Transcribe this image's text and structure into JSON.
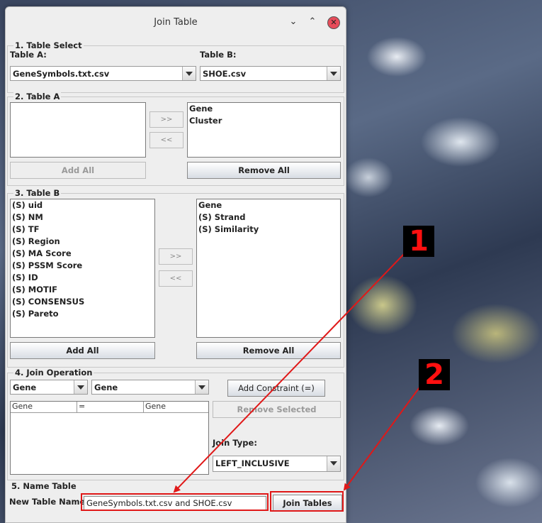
{
  "window": {
    "title": "Join Table"
  },
  "table_select": {
    "heading": "1. Table Select",
    "table_a_label": "Table A:",
    "table_b_label": "Table B:",
    "table_a_value": "GeneSymbols.txt.csv",
    "table_b_value": "SHOE.csv"
  },
  "table_a": {
    "heading": "2. Table A",
    "available": [],
    "selected": [
      "Gene",
      "Cluster"
    ],
    "add_label": ">>",
    "remove_label": "<<",
    "add_all_label": "Add All",
    "remove_all_label": "Remove All"
  },
  "table_b": {
    "heading": "3. Table B",
    "available": [
      "(S) uid",
      "(S) NM",
      "(S) TF",
      "(S) Region",
      "(S) MA Score",
      "(S) PSSM Score",
      "(S) ID",
      "(S) MOTIF",
      "(S) CONSENSUS",
      "(S) Pareto"
    ],
    "selected": [
      "Gene",
      "(S) Strand",
      "(S) Similarity"
    ],
    "add_label": ">>",
    "remove_label": "<<",
    "add_all_label": "Add All",
    "remove_all_label": "Remove All"
  },
  "join_operation": {
    "heading": "4. Join Operation",
    "left_field": "Gene",
    "right_field": "Gene",
    "add_constraint_label": "Add Constraint (=)",
    "remove_selected_label": "Remove Selected",
    "constraint_columns": [
      "Gene",
      "=",
      "Gene"
    ],
    "join_type_label": "Join Type:",
    "join_type_value": "LEFT_INCLUSIVE"
  },
  "name_table": {
    "heading": "5. Name Table",
    "new_name_label": "New Table Name:",
    "new_name_value": "GeneSymbols.txt.csv and SHOE.csv",
    "join_button_label": "Join Tables"
  },
  "annotations": {
    "marker_1": "1",
    "marker_2": "2",
    "color": "#e01818"
  }
}
